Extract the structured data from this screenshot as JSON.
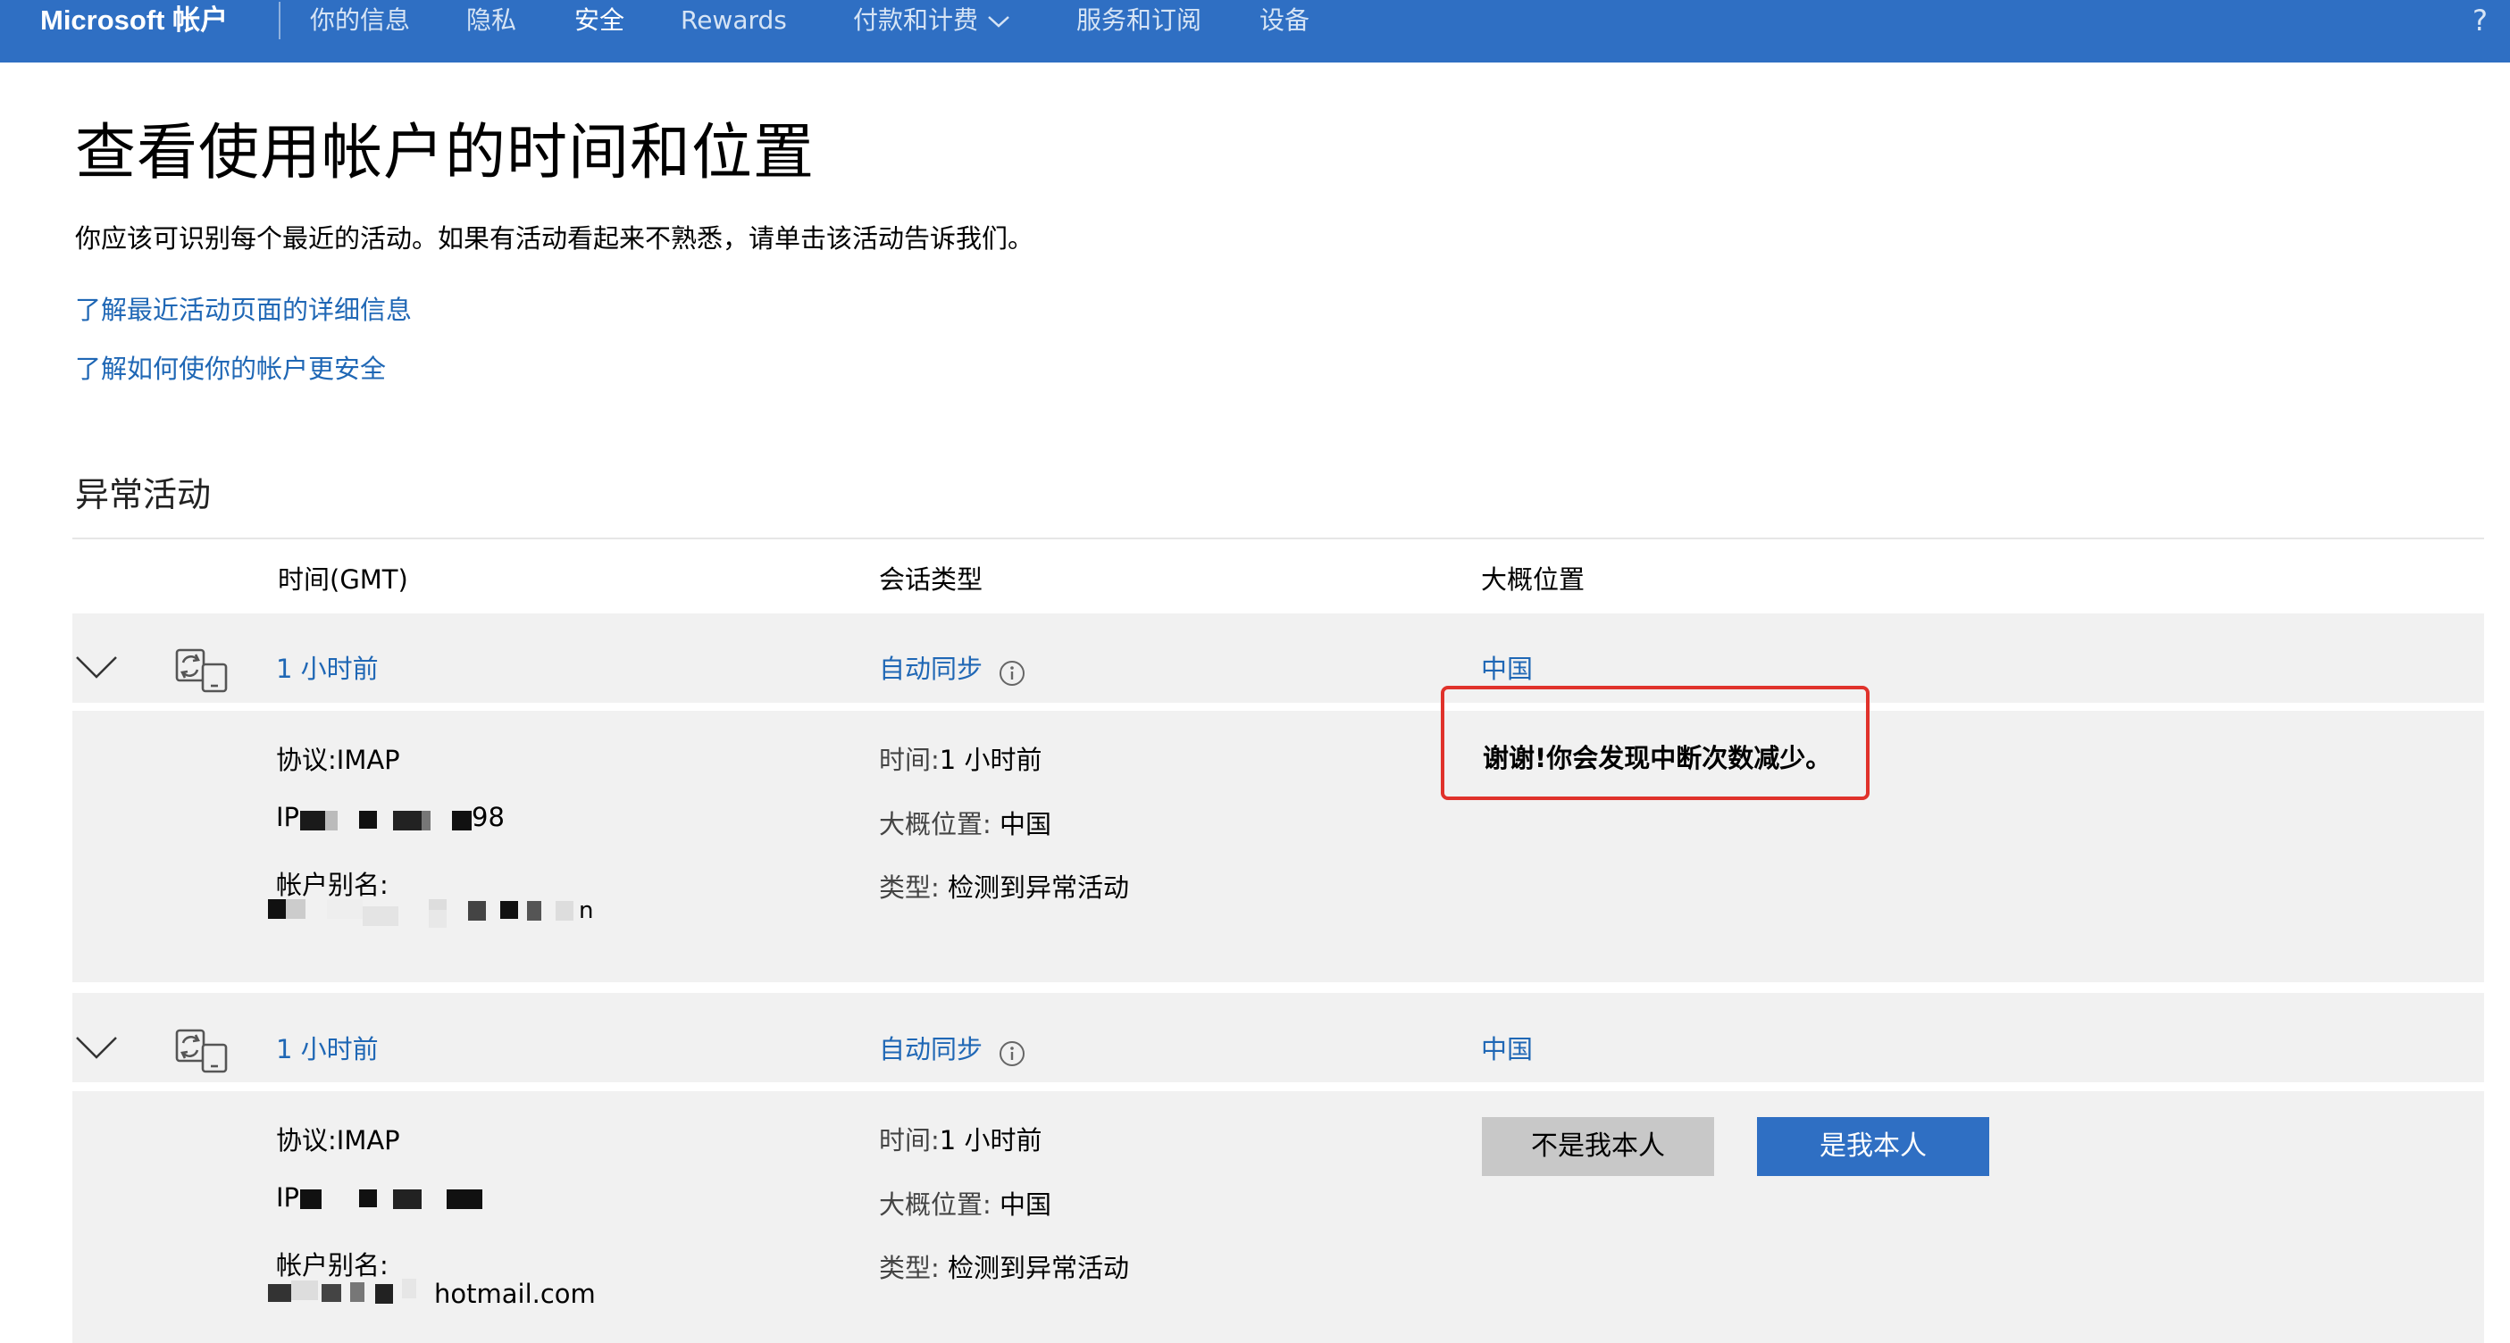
{
  "header": {
    "brand": "Microsoft 帐户",
    "nav": [
      "你的信息",
      "隐私",
      "安全",
      "Rewards",
      "付款和计费",
      "服务和订阅",
      "设备"
    ],
    "help": "?"
  },
  "page": {
    "title": "查看使用帐户的时间和位置",
    "intro": "你应该可识别每个最近的活动。如果有活动看起来不熟悉，请单击该活动告诉我们。",
    "links": [
      "了解最近活动页面的详细信息",
      "了解如何使你的帐户更安全"
    ],
    "section_title": "异常活动"
  },
  "table": {
    "headers": {
      "time": "时间(GMT)",
      "session_type": "会话类型",
      "location": "大概位置"
    }
  },
  "rows": [
    {
      "time": "1 小时前",
      "session_type": "自动同步",
      "location": "中国",
      "protocol": "协议:IMAP",
      "ip_label": "IP",
      "ip_visible_suffix": "98",
      "alias_label": "帐户别名:",
      "alias_visible_suffix": "n",
      "detail_time_label": "时间:",
      "detail_time_value": "1 小时前",
      "detail_loc_label": "大概位置:",
      "detail_loc_value": "中国",
      "detail_type_label": "类型:",
      "detail_type_value": "检测到异常活动",
      "feedback": "谢谢!你会发现中断次数减少。"
    },
    {
      "time": "1 小时前",
      "session_type": "自动同步",
      "location": "中国",
      "protocol": "协议:IMAP",
      "ip_label": "IP",
      "alias_label": "帐户别名:",
      "alias_visible_suffix": "hotmail.com",
      "detail_time_label": "时间:",
      "detail_time_value": "1 小时前",
      "detail_loc_label": "大概位置:",
      "detail_loc_value": "中国",
      "detail_type_label": "类型:",
      "detail_type_value": "检测到异常活动",
      "buttons": {
        "not_me": "不是我本人",
        "me": "是我本人"
      }
    }
  ],
  "colors": {
    "brand_blue": "#2f6fc3",
    "link_blue": "#1f67b5",
    "callout_red": "#e0322b",
    "band_gray": "#f1f1f1"
  },
  "icons": [
    "chevron-down-icon",
    "sync-device-icon",
    "info-icon",
    "caret-down-icon"
  ]
}
